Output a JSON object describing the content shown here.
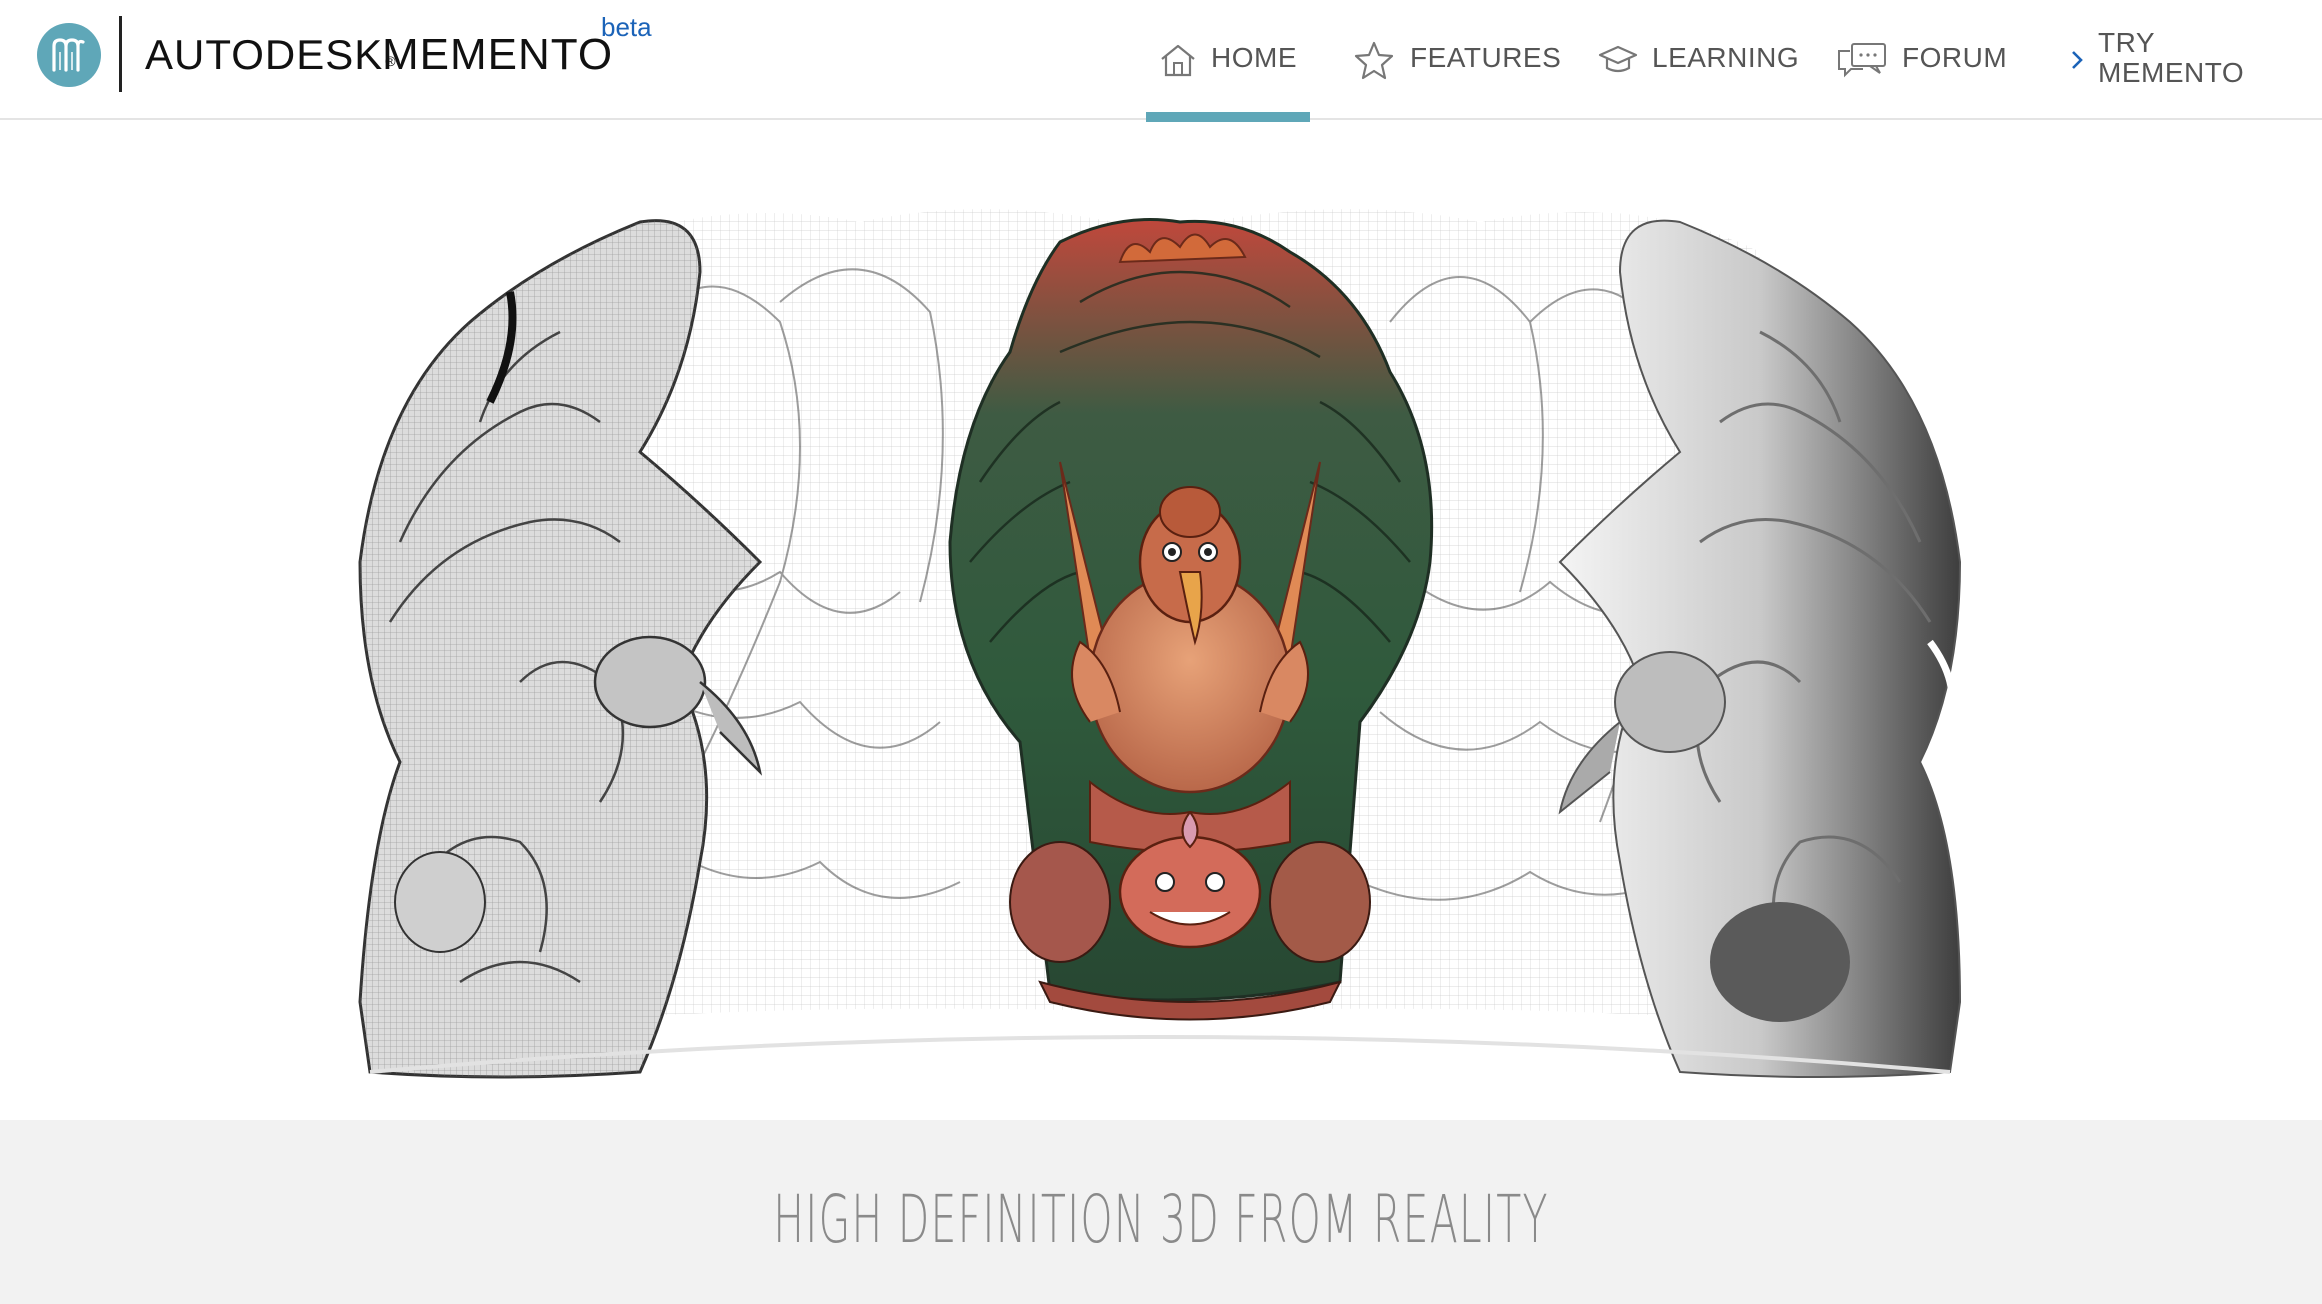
{
  "header": {
    "logo_icon": "memento-m-logo-icon",
    "brand_company": "AUTODESK",
    "brand_registered": "®",
    "brand_product": "MEMENTO",
    "beta_label": "beta",
    "accent_color": "#5fa7b8",
    "beta_color": "#1b63b8"
  },
  "nav": {
    "items": [
      {
        "label": "HOME",
        "icon": "home-icon",
        "active": true
      },
      {
        "label": "FEATURES",
        "icon": "star-icon",
        "active": false
      },
      {
        "label": "LEARNING",
        "icon": "graduation-cap-icon",
        "active": false
      },
      {
        "label": "FORUM",
        "icon": "chat-bubbles-icon",
        "active": false
      },
      {
        "label": "TRY MEMENTO",
        "icon": "chevron-right-icon",
        "active": false
      }
    ]
  },
  "hero": {
    "image": "garuda-statue-3d-scan-rotation-showcase"
  },
  "tagline": {
    "text": "HIGH DEFINITION 3D FROM REALITY"
  }
}
